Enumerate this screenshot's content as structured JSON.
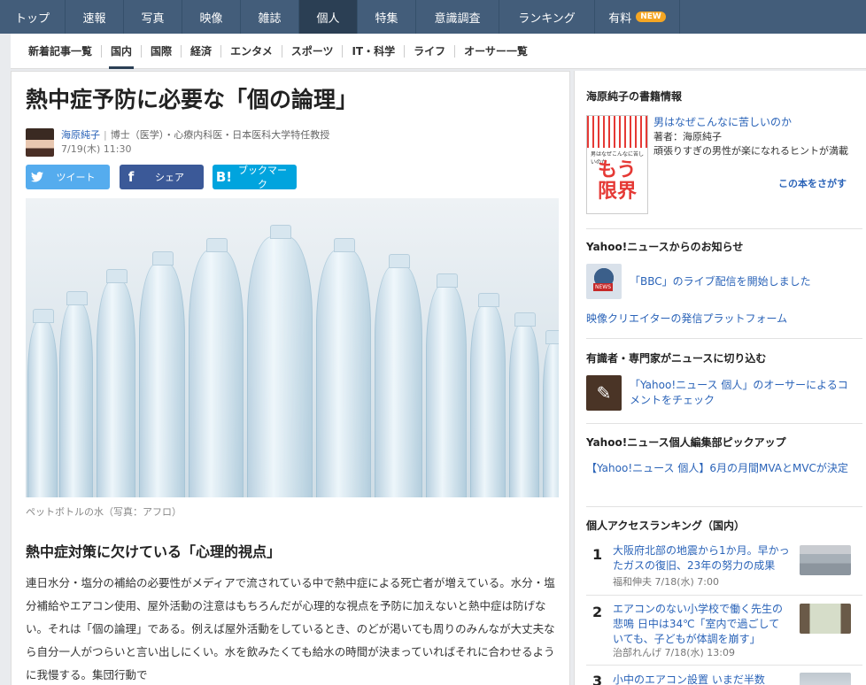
{
  "topnav": {
    "tabs": [
      {
        "label": "トップ",
        "active": false
      },
      {
        "label": "速報",
        "active": false
      },
      {
        "label": "写真",
        "active": false
      },
      {
        "label": "映像",
        "active": false
      },
      {
        "label": "雑誌",
        "active": false
      },
      {
        "label": "個人",
        "active": true
      },
      {
        "label": "特集",
        "active": false
      },
      {
        "label": "意識調査",
        "active": false
      },
      {
        "label": "ランキング",
        "active": false
      },
      {
        "label": "有料",
        "active": false,
        "badge": "NEW"
      }
    ]
  },
  "subnav": {
    "items": [
      {
        "label": "新着記事一覧",
        "active": false
      },
      {
        "label": "国内",
        "active": true
      },
      {
        "label": "国際",
        "active": false
      },
      {
        "label": "経済",
        "active": false
      },
      {
        "label": "エンタメ",
        "active": false
      },
      {
        "label": "スポーツ",
        "active": false
      },
      {
        "label": "IT・科学",
        "active": false
      },
      {
        "label": "ライフ",
        "active": false
      },
      {
        "label": "オーサー一覧",
        "active": false
      }
    ]
  },
  "article": {
    "title": "熱中症予防に必要な「個の論理」",
    "author_name": "海原純子",
    "author_sep": "|",
    "author_title": "博士（医学）・心療内科医・日本医科大学特任教授",
    "date": "7/19(木) 11:30",
    "share": {
      "tweet": "ツイート",
      "facebook": "シェア",
      "hatena": "ブックマーク"
    },
    "image_caption": "ペットボトルの水（写真：アフロ）",
    "section_heading": "熱中症対策に欠けている「心理的視点」",
    "body": "連日水分・塩分の補給の必要性がメディアで流されている中で熱中症による死亡者が増えている。水分・塩分補給やエアコン使用、屋外活動の注意はもちろんだが心理的な視点を予防に加えないと熱中症は防げない。それは「個の論理」である。例えば屋外活動をしているとき、のどが渇いても周りのみんなが大丈夫なら自分一人がつらいと言い出しにくい。水を飲みたくても給水の時間が決まっていればそれに合わせるように我慢する。集団行動で"
  },
  "sidebar": {
    "book": {
      "heading": "海原純子の書籍情報",
      "cover_small": "男はなぜこんなに苦しいのか",
      "cover_big": "もう限界",
      "title": "男はなぜこんなに苦しいのか",
      "author": "著者：海原純子",
      "description": "頑張りすぎの男性が楽になれるヒントが満載",
      "more": "この本をさがす"
    },
    "notice": {
      "heading": "Yahoo!ニュースからのお知らせ",
      "thumb_tag": "NEWS",
      "item1": "「BBC」のライブ配信を開始しました",
      "item2": "映像クリエイターの発信プラットフォーム"
    },
    "experts": {
      "heading": "有識者・専門家がニュースに切り込む",
      "item": "「Yahoo!ニュース 個人」のオーサーによるコメントをチェック"
    },
    "pickup": {
      "heading": "Yahoo!ニュース個人編集部ピックアップ",
      "item": "【Yahoo!ニュース 個人】6月の月間MVAとMVCが決定"
    },
    "ranking": {
      "heading": "個人アクセスランキング（国内）",
      "items": [
        {
          "rank": "1",
          "title": "大阪府北部の地震から1か月。早かったガスの復旧、23年の努力の成果",
          "meta": "福和伸夫 7/18(水) 7:00"
        },
        {
          "rank": "2",
          "title": "エアコンのない小学校で働く先生の悲鳴 日中は34℃「室内で過ごしていても、子どもが体調を崩す」",
          "meta": "治部れんげ 7/18(水) 13:09"
        },
        {
          "rank": "3",
          "title": "小中のエアコン設置 いまだ半数",
          "meta": ""
        }
      ]
    }
  }
}
